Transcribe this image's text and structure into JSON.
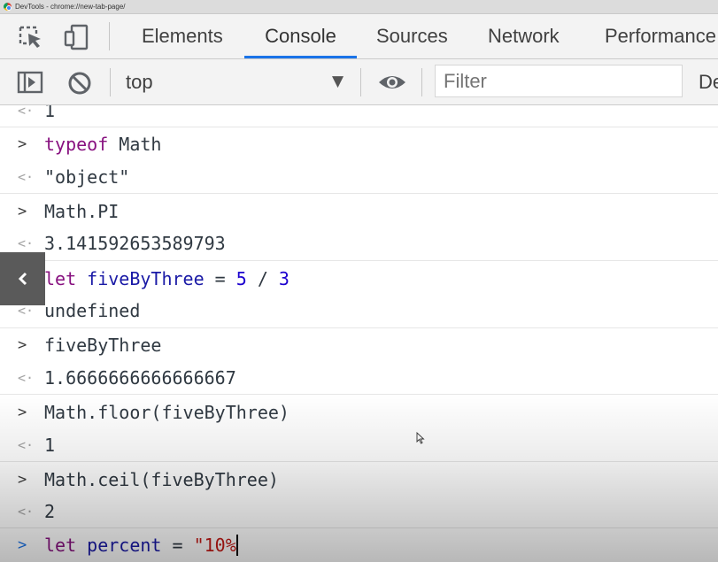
{
  "window": {
    "title": "DevTools - chrome://new-tab-page/"
  },
  "tabs": [
    {
      "label": "Elements"
    },
    {
      "label": "Console",
      "active": true
    },
    {
      "label": "Sources"
    },
    {
      "label": "Network"
    },
    {
      "label": "Performance"
    }
  ],
  "toolbar": {
    "context": "top",
    "filter_placeholder": "Filter",
    "default_levels": "De"
  },
  "console": {
    "entries": [
      {
        "kind": "output",
        "text": "1"
      },
      {
        "kind": "input",
        "text": "typeof Math"
      },
      {
        "kind": "output",
        "text": "\"object\""
      },
      {
        "kind": "input",
        "text": "Math.PI"
      },
      {
        "kind": "output",
        "text": "3.141592653589793"
      },
      {
        "kind": "input",
        "text": "let fiveByThree = 5 / 3"
      },
      {
        "kind": "output",
        "text": "undefined"
      },
      {
        "kind": "input",
        "text": "fiveByThree"
      },
      {
        "kind": "output",
        "text": "1.6666666666666667"
      },
      {
        "kind": "input",
        "text": "Math.floor(fiveByThree)"
      },
      {
        "kind": "output",
        "text": "1"
      },
      {
        "kind": "input",
        "text": "Math.ceil(fiveByThree)"
      },
      {
        "kind": "output",
        "text": "2"
      }
    ],
    "prompt": {
      "text": "let percent = \"10%"
    }
  },
  "icons": {
    "inspect": "inspect-element-icon",
    "device": "device-toolbar-icon",
    "sidebar": "show-sidebar-icon",
    "clear": "clear-console-icon",
    "eye": "live-expression-eye-icon",
    "back": "chevron-left-icon"
  }
}
